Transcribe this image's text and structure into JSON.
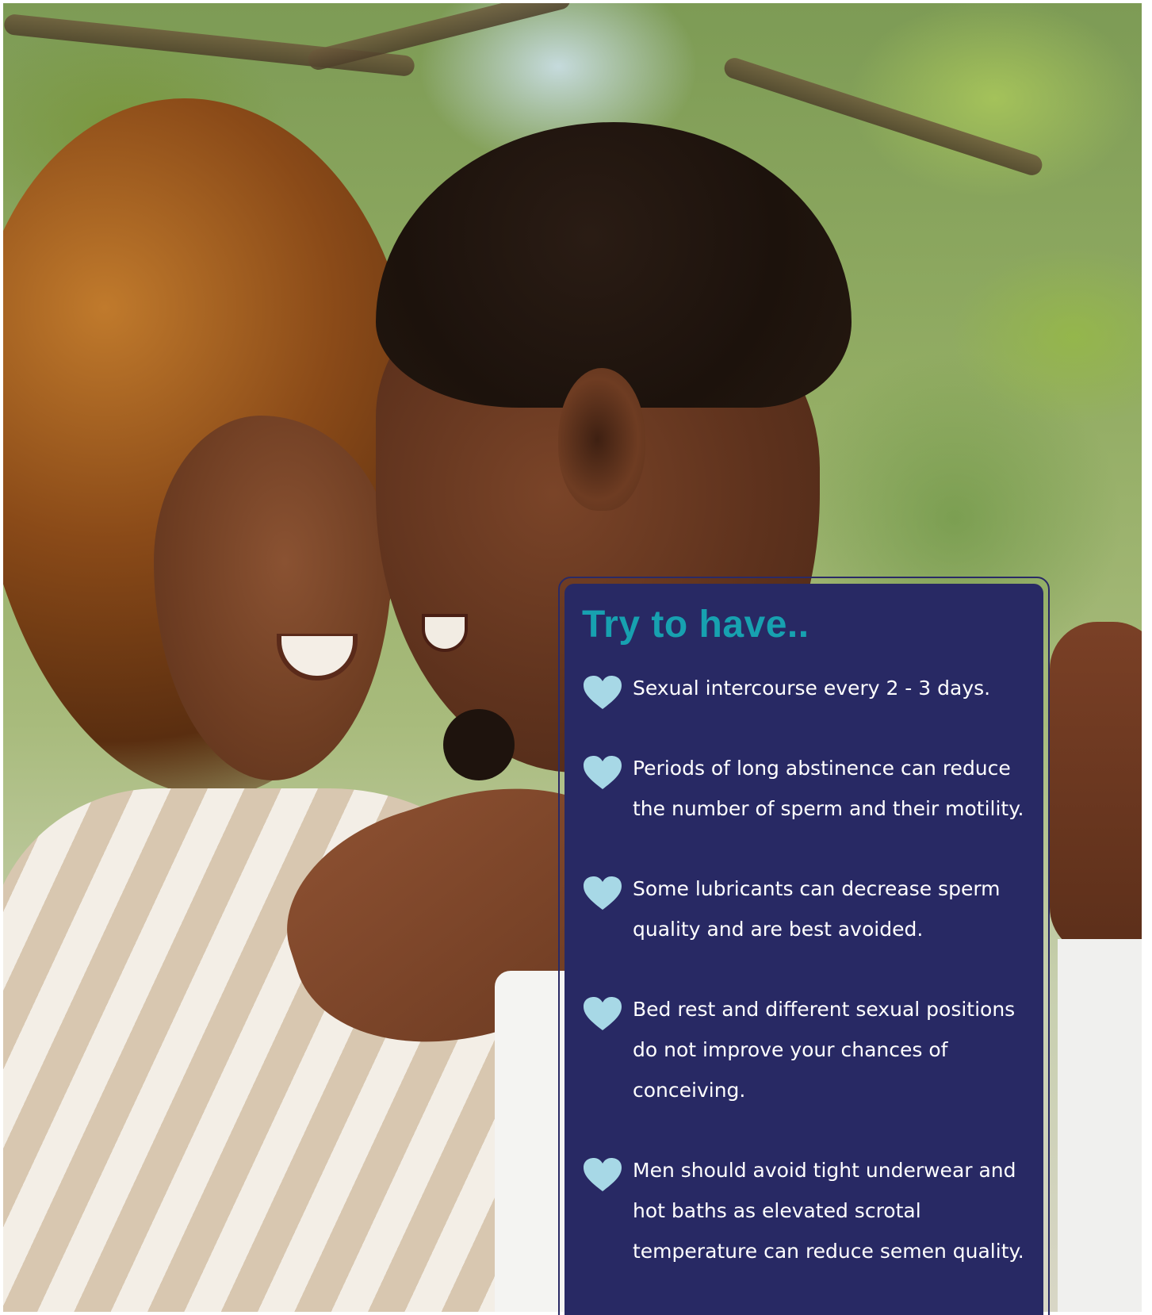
{
  "card": {
    "title": "Try to have..",
    "colors": {
      "background": "#282964",
      "title": "#17a1b0",
      "text": "#ffffff",
      "heart": "#a7d8e6"
    },
    "tips": [
      {
        "icon": "heart-icon",
        "text": "Sexual intercourse every 2 - 3 days."
      },
      {
        "icon": "heart-icon",
        "text": "Periods of long abstinence can reduce the number of sperm and their motility."
      },
      {
        "icon": "heart-icon",
        "text": "Some lubricants can decrease sperm quality and are best avoided."
      },
      {
        "icon": "heart-icon",
        "text": "Bed rest and different sexual positions do not improve your chances of conceiving."
      },
      {
        "icon": "heart-icon",
        "text": "Men should avoid tight underwear and hot baths as elevated scrotal temperature can reduce semen quality."
      }
    ]
  }
}
